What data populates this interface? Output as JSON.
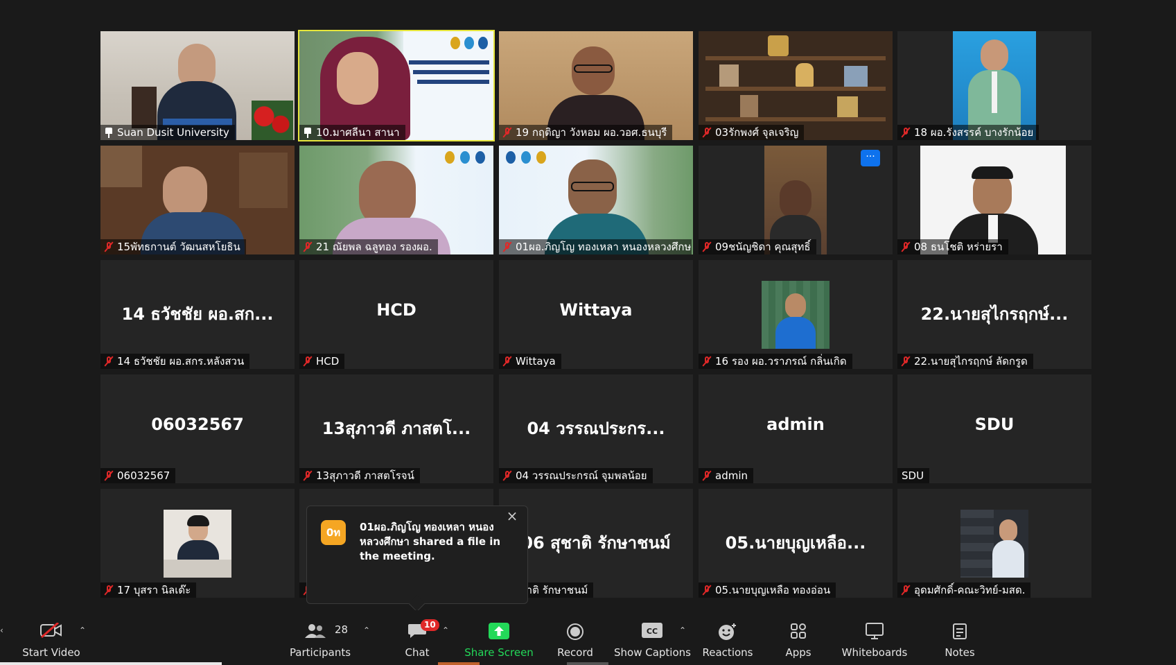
{
  "tiles": [
    {
      "label": "Suan Dusit University",
      "icon": "pin",
      "active": false
    },
    {
      "label": "10.มาศลีนา  สานา",
      "icon": "pin",
      "active": true
    },
    {
      "label": "19 กฤติญา วังหอม ผอ.วอศ.ธนบุรี",
      "icon": "mic-off"
    },
    {
      "label": "03รักพงศ์ จุลเจริญ",
      "icon": "mic-off"
    },
    {
      "label": "18 ผอ.รังสรรค์ บางรักน้อย",
      "icon": "mic-off"
    },
    {
      "label": "15พัทธกานต์  วัฒนสหโยธิน",
      "icon": "mic-off"
    },
    {
      "label": "21 ณัยพล ฉลูทอง รองผอ.",
      "icon": "mic-off"
    },
    {
      "label": "01ผอ.ภิญโญ  ทองเหลา หนองหลวงศึกษา",
      "icon": "mic-off"
    },
    {
      "label": "09ชนัญชิดา  คุณสุทธิ์",
      "icon": "mic-off"
    },
    {
      "label": "08 ธนโชติ  หร่ายรา",
      "icon": "mic-off"
    },
    {
      "label": "14 ธวัชชัย ผอ.สกร.หลังสวน",
      "icon": "mic-off",
      "display": "14 ธวัชชัย ผอ.สก..."
    },
    {
      "label": "HCD",
      "icon": "mic-off",
      "display": "HCD"
    },
    {
      "label": "Wittaya",
      "icon": "mic-off",
      "display": "Wittaya"
    },
    {
      "label": "16 รอง ผอ.วราภรณ์ กลิ่นเกิด",
      "icon": "mic-off"
    },
    {
      "label": "22.นายสุไกรฤกษ์ ลัดกรูด",
      "icon": "mic-off",
      "display": "22.นายสุไกรฤกษ์..."
    },
    {
      "label": "06032567",
      "icon": "mic-off",
      "display": "06032567"
    },
    {
      "label": "13สุภาวดี ภาสตโรจน์",
      "icon": "mic-off",
      "display": "13สุภาวดี ภาสตโ..."
    },
    {
      "label": "04 วรรณประกรณ์  จุมพลน้อย",
      "icon": "mic-off",
      "display": "04 วรรณประกร..."
    },
    {
      "label": "admin",
      "icon": "mic-off",
      "display": "admin"
    },
    {
      "label": "SDU",
      "icon": "none",
      "display": "SDU"
    },
    {
      "label": "17 บุสรา นิลเด๊ะ",
      "icon": "mic-off"
    },
    {
      "label": "",
      "icon": "mic-off"
    },
    {
      "label": "5 สุชาติ รักษาชนม์",
      "icon": "none",
      "display": "06 สุชาติ รักษาชนม์"
    },
    {
      "label": "05.นายบุญเหลือ ทองอ่อน",
      "icon": "mic-off",
      "display": "05.นายบุญเหลือ..."
    },
    {
      "label": "อุดมศักดิ์-คณะวิทย์-มสด.",
      "icon": "mic-off"
    }
  ],
  "notification": {
    "avatar": "0ท",
    "message": "01ผอ.ภิญโญ  ทองเหลา หนองหลวงศึกษา shared a file in the meeting."
  },
  "toolbar": {
    "start_video": "Start Video",
    "participants": "Participants",
    "participants_count": "28",
    "chat": "Chat",
    "chat_badge": "10",
    "share_screen": "Share Screen",
    "record": "Record",
    "show_captions": "Show Captions",
    "reactions": "Reactions",
    "apps": "Apps",
    "whiteboards": "Whiteboards",
    "notes": "Notes"
  },
  "colors": {
    "background": "#1a1a1a",
    "tile": "#252525",
    "active_speaker": "#e6e63c",
    "mute_red": "#e02828",
    "share_green": "#23d959",
    "toast_avatar": "#f5a623"
  }
}
